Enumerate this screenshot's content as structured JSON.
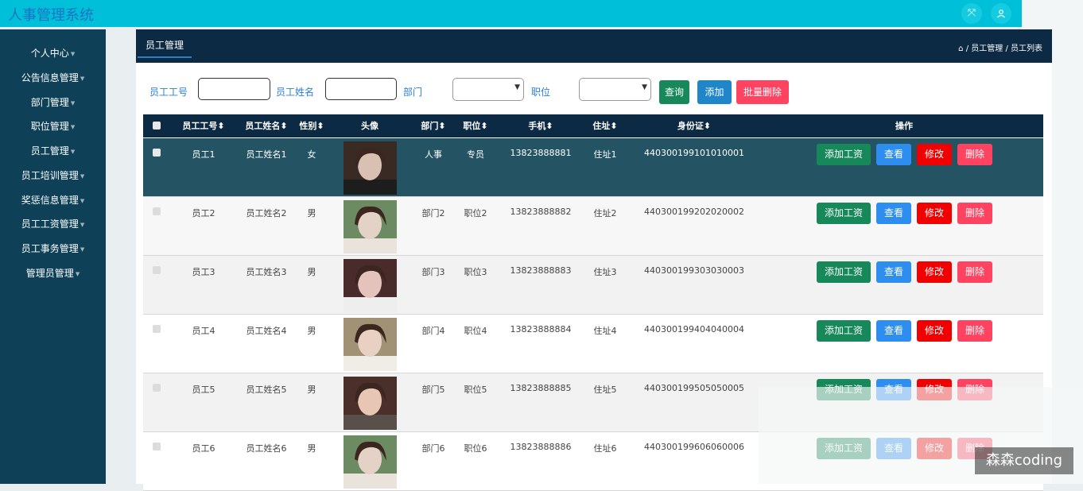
{
  "app": {
    "title": "人事管理系统"
  },
  "topbar": {
    "fullscreen_icon": "expand-icon",
    "user_icon": "user-icon"
  },
  "sidebar": {
    "items": [
      {
        "label": "个人中心"
      },
      {
        "label": "公告信息管理"
      },
      {
        "label": "部门管理"
      },
      {
        "label": "职位管理"
      },
      {
        "label": "员工管理"
      },
      {
        "label": "员工培训管理"
      },
      {
        "label": "奖惩信息管理"
      },
      {
        "label": "员工工资管理"
      },
      {
        "label": "员工事务管理"
      },
      {
        "label": "管理员管理"
      }
    ]
  },
  "panel": {
    "tab": "员工管理",
    "breadcrumb": {
      "home_icon": "home-icon",
      "sep": "/",
      "level1": "员工管理",
      "level2": "员工列表"
    }
  },
  "filters": {
    "employee_id_label": "员工工号",
    "employee_id_value": "",
    "employee_name_label": "员工姓名",
    "employee_name_value": "",
    "department_label": "部门",
    "department_value": "",
    "position_label": "职位",
    "position_value": "",
    "query_button": "查询",
    "add_button": "添加",
    "batch_delete_button": "批量删除"
  },
  "table": {
    "headers": {
      "id": "员工工号",
      "name": "员工姓名",
      "gender": "性别",
      "avatar": "头像",
      "department": "部门",
      "position": "职位",
      "phone": "手机",
      "address": "住址",
      "idcard": "身份证",
      "actions": "操作"
    },
    "sort_glyph": "⬍",
    "action_labels": {
      "add_salary": "添加工资",
      "view": "查看",
      "edit": "修改",
      "delete": "删除"
    },
    "rows": [
      {
        "id": "员工1",
        "name": "员工姓名1",
        "gender": "女",
        "department": "人事",
        "position": "专员",
        "phone": "13823888881",
        "address": "住址1",
        "idcard": "440300199101010001"
      },
      {
        "id": "员工2",
        "name": "员工姓名2",
        "gender": "男",
        "department": "部门2",
        "position": "职位2",
        "phone": "13823888882",
        "address": "住址2",
        "idcard": "440300199202020002"
      },
      {
        "id": "员工3",
        "name": "员工姓名3",
        "gender": "男",
        "department": "部门3",
        "position": "职位3",
        "phone": "13823888883",
        "address": "住址3",
        "idcard": "440300199303030003"
      },
      {
        "id": "员工4",
        "name": "员工姓名4",
        "gender": "男",
        "department": "部门4",
        "position": "职位4",
        "phone": "13823888884",
        "address": "住址4",
        "idcard": "440300199404040004"
      },
      {
        "id": "员工5",
        "name": "员工姓名5",
        "gender": "男",
        "department": "部门5",
        "position": "职位5",
        "phone": "13823888885",
        "address": "住址5",
        "idcard": "440300199505050005"
      },
      {
        "id": "员工6",
        "name": "员工姓名6",
        "gender": "男",
        "department": "部门6",
        "position": "职位6",
        "phone": "13823888886",
        "address": "住址6",
        "idcard": "440300199606060006"
      }
    ]
  },
  "watermark": "森森coding",
  "colors": {
    "topbar": "#00c0d9",
    "sidebar": "#0e4057",
    "header_dark": "#0c2a43",
    "hover_row": "#245464",
    "btn_green": "#17885a",
    "btn_blue": "#2d8ef0",
    "btn_red": "#f00000",
    "btn_pink": "#ff4360"
  }
}
